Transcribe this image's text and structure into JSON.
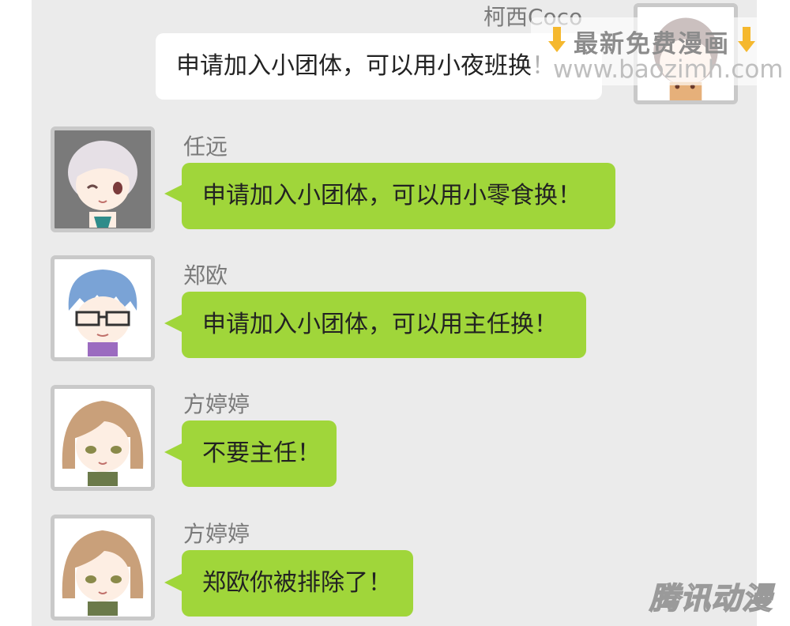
{
  "messages": [
    {
      "sender": "柯西Coco",
      "text": "申请加入小团体，可以用小夜班换！",
      "side": "right",
      "avatar_icon": "coco-avatar-icon"
    },
    {
      "sender": "任远",
      "text": "申请加入小团体，可以用小零食换！",
      "side": "left",
      "avatar_icon": "renyuan-avatar-icon"
    },
    {
      "sender": "郑欧",
      "text": "申请加入小团体，可以用主任换！",
      "side": "left",
      "avatar_icon": "zhengou-avatar-icon"
    },
    {
      "sender": "方婷婷",
      "text": "不要主任！",
      "side": "left",
      "avatar_icon": "fangtingting-avatar-icon"
    },
    {
      "sender": "方婷婷",
      "text": "郑欧你被排除了！",
      "side": "left",
      "avatar_icon": "fangtingting-avatar-icon"
    }
  ],
  "watermarks": {
    "site_title": "最新免费漫画",
    "site_url": "www.baozimh.com",
    "logo_text": "腾讯动漫",
    "hand_icon": "pointing-hand-icon"
  },
  "colors": {
    "panel_bg": "#ebebeb",
    "bubble_green": "#a0d63a",
    "bubble_white": "#ffffff",
    "avatar_border": "#c9c9c9"
  }
}
